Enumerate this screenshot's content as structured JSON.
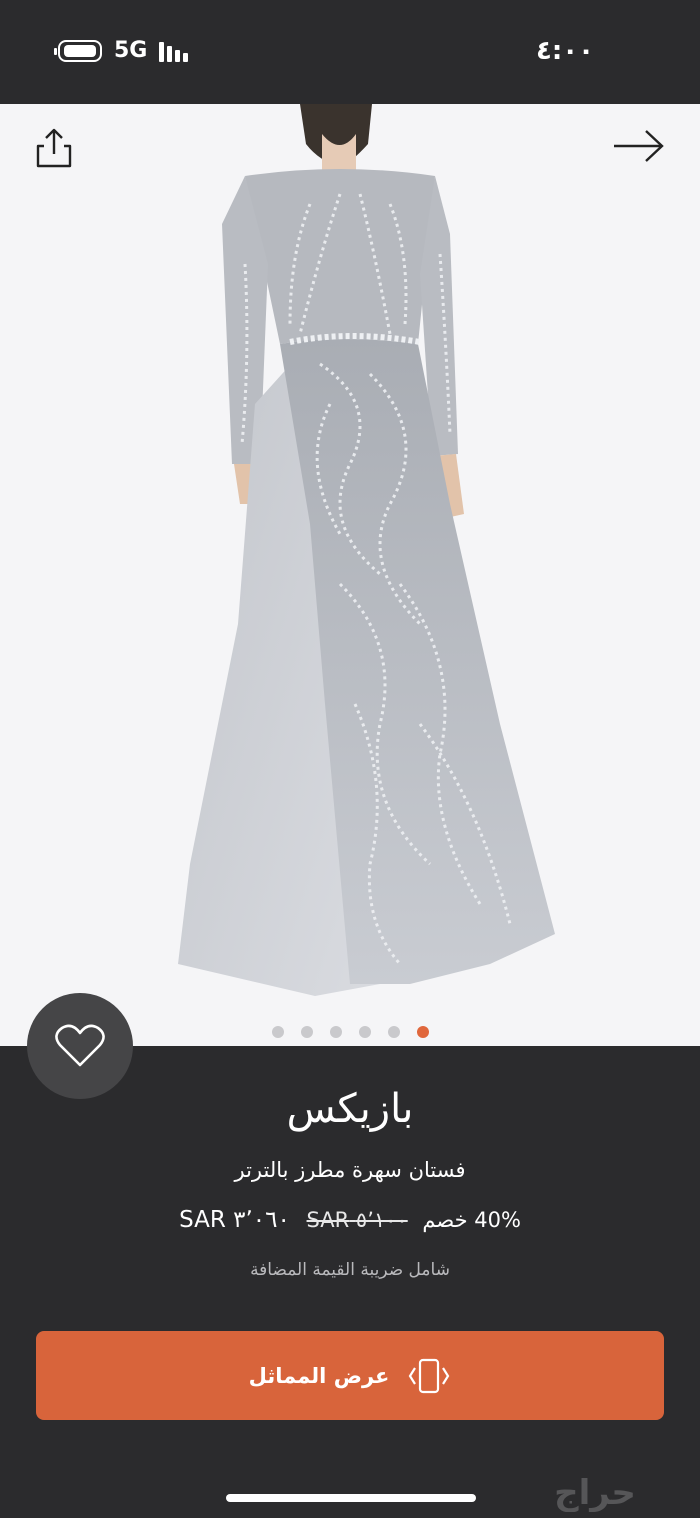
{
  "status_bar": {
    "network": "5G",
    "time": "٤:٠٠"
  },
  "icons": {
    "share": "share-icon",
    "next": "arrow-right-icon",
    "favorite": "heart-icon",
    "cta": "phone-icon"
  },
  "gallery": {
    "dot_count": 6,
    "active_index": 5
  },
  "product": {
    "brand": "بازيكس",
    "name": "فستان سهرة مطرز بالترتر",
    "discount": "40% خصم",
    "old_price": "٥٬١٠٠ SAR",
    "price": "٣٬٠٦٠ SAR",
    "vat_note": "شامل ضريبة القيمة المضافة"
  },
  "cta": {
    "label": "عرض المماثل"
  },
  "watermark": {
    "text": "حراج"
  },
  "colors": {
    "background": "#2b2b2d",
    "accent": "#d8643b",
    "active_dot": "#e0673c"
  }
}
